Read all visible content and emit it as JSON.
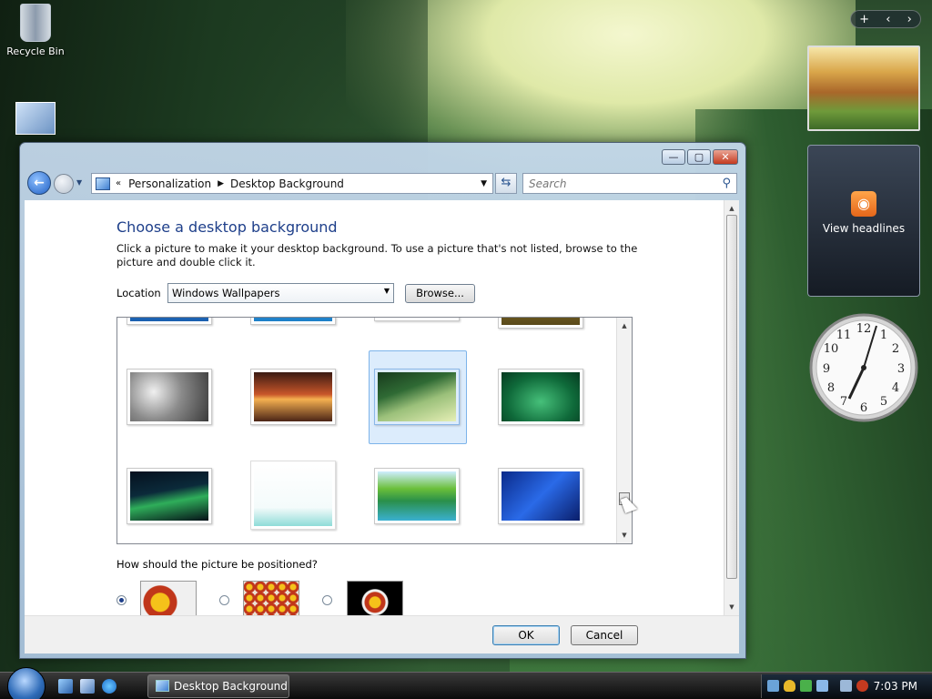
{
  "desktop": {
    "recycle_bin_label": "Recycle Bin"
  },
  "gadgets": {
    "feed_label": "View headlines",
    "slideshow_controls": [
      "+",
      "‹",
      "›"
    ]
  },
  "window": {
    "title_buttons": {
      "minimize": "—",
      "maximize": "▢",
      "close": "✕"
    },
    "nav": {
      "breadcrumb_prefix": "«",
      "breadcrumb": [
        "Personalization",
        "Desktop Background"
      ],
      "search_placeholder": "Search"
    },
    "heading": "Choose a desktop background",
    "description": "Click a picture to make it your desktop background. To use a picture that's not listed, browse to the picture and double click it.",
    "location_label": "Location",
    "location_value": "Windows Wallpapers",
    "browse_label": "Browse...",
    "position_question": "How should the picture be positioned?",
    "positions": [
      {
        "name": "fit-to-screen",
        "selected": true
      },
      {
        "name": "tile",
        "selected": false
      },
      {
        "name": "center",
        "selected": false
      }
    ],
    "ok_label": "OK",
    "cancel_label": "Cancel"
  },
  "taskbar": {
    "task_label": "Desktop Background",
    "time": "7:03 PM"
  },
  "colors": {
    "heading": "#1e3f8a",
    "selection": "#dcecfc",
    "selection_border": "#7db4ea"
  },
  "icons": [
    "recycle-bin-icon",
    "back-icon",
    "forward-icon",
    "control-panel-icon",
    "refresh-icon",
    "search-icon",
    "rss-icon",
    "clock-gadget",
    "start-orb-icon",
    "show-desktop-icon",
    "switch-windows-icon",
    "ie-icon"
  ]
}
